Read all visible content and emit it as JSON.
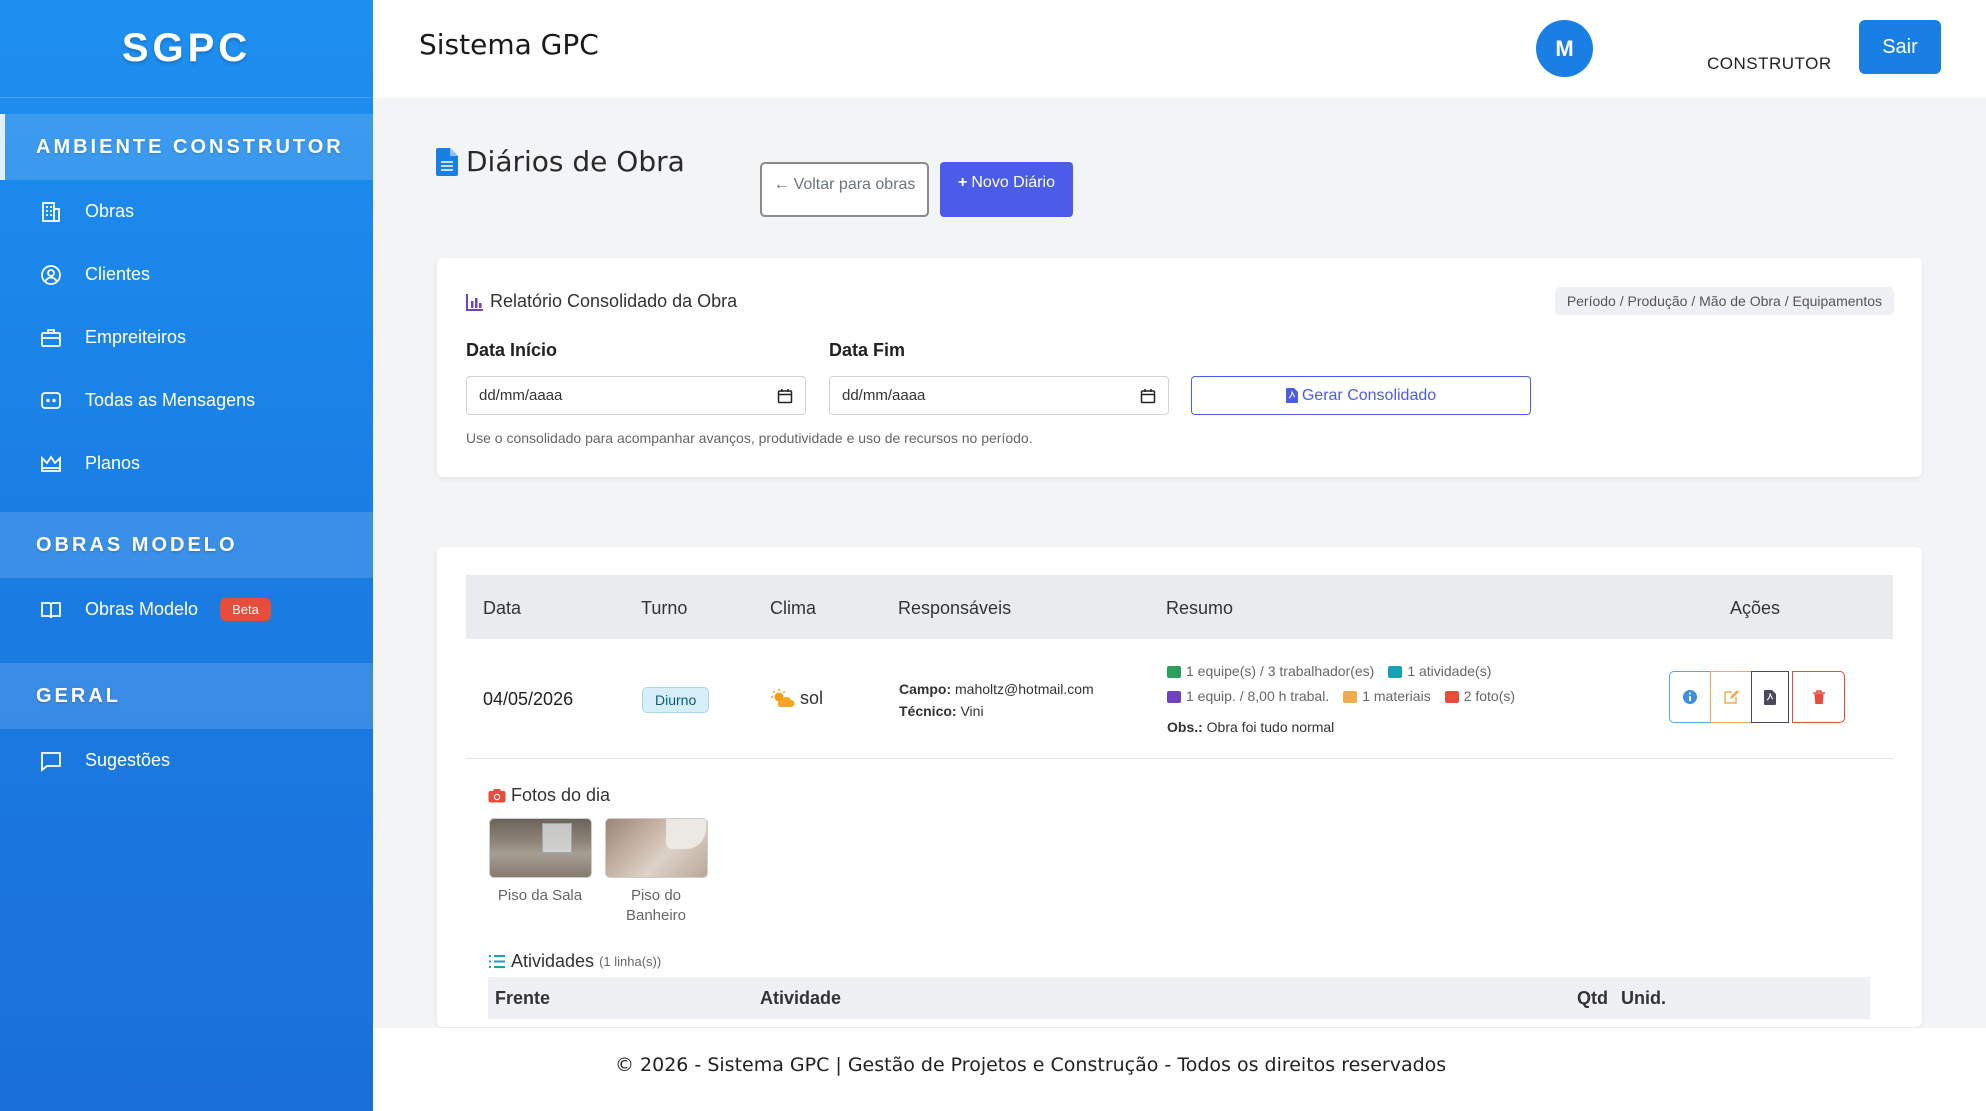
{
  "brand": "SGPC",
  "sidebar": {
    "sections": [
      {
        "title": "AMBIENTE CONSTRUTOR",
        "items": [
          "Obras",
          "Clientes",
          "Empreiteiros",
          "Todas as Mensagens",
          "Planos"
        ]
      },
      {
        "title": "OBRAS MODELO",
        "items": [
          "Obras Modelo"
        ],
        "badge": "Beta"
      },
      {
        "title": "GERAL",
        "items": [
          "Sugestões"
        ]
      }
    ]
  },
  "header": {
    "title": "Sistema GPC",
    "avatar_initial": "M",
    "role": "CONSTRUTOR",
    "logout_label": "Sair"
  },
  "page": {
    "title": "Diários de Obra",
    "back_label": "Voltar para obras",
    "new_label": "Novo Diário"
  },
  "report": {
    "title": "Relatório Consolidado da Obra",
    "tag": "Período / Produção / Mão de Obra / Equipamentos",
    "start_label": "Data Início",
    "end_label": "Data Fim",
    "date_placeholder": "dd/mm/aaaa",
    "generate_label": "Gerar Consolidado",
    "hint": "Use o consolidado para acompanhar avanços, produtividade e uso de recursos no período."
  },
  "table": {
    "headers": [
      "Data",
      "Turno",
      "Clima",
      "Responsáveis",
      "Resumo",
      "Ações"
    ],
    "row": {
      "date": "04/05/2026",
      "shift": "Diurno",
      "weather": "sol",
      "campo_label": "Campo:",
      "campo_value": "maholtz@hotmail.com",
      "tecnico_label": "Técnico:",
      "tecnico_value": "Vini",
      "summary_teams": "1 equipe(s) / 3 trabalhador(es)",
      "summary_activities": "1 atividade(s)",
      "summary_equipment": "1 equip. / 8,00 h trabal.",
      "summary_materials": "1 materiais",
      "summary_photos": "2 foto(s)",
      "obs_label": "Obs.:",
      "obs_value": "Obra foi tudo normal"
    }
  },
  "photos": {
    "title": "Fotos do dia",
    "items": [
      {
        "caption_line1": "Piso da Sala",
        "caption_line2": ""
      },
      {
        "caption_line1": "Piso do",
        "caption_line2": "Banheiro"
      }
    ]
  },
  "activities": {
    "title": "Atividades",
    "count": "(1 linha(s))",
    "headers": [
      "Frente",
      "Atividade",
      "Qtd",
      "Unid."
    ]
  },
  "footer": "© 2026 - Sistema GPC | Gestão de Projetos e Construção - Todos os direitos reservados",
  "colors": {
    "primary": "#1a7fe4",
    "accent": "#4b5ce8",
    "danger": "#e74c3c",
    "warning": "#f0ad4e"
  }
}
